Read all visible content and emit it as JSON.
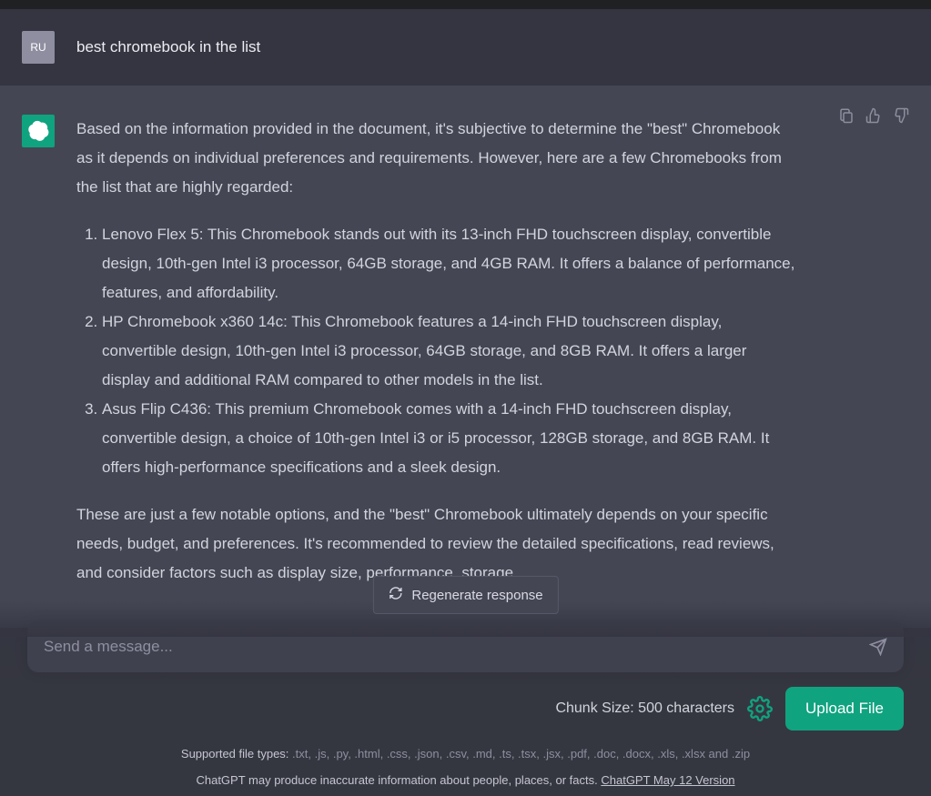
{
  "user": {
    "avatar_initials": "RU",
    "message": "best chromebook in the list"
  },
  "assistant": {
    "intro": "Based on the information provided in the document, it's subjective to determine the \"best\" Chromebook as it depends on individual preferences and requirements. However, here are a few Chromebooks from the list that are highly regarded:",
    "items": [
      "Lenovo Flex 5: This Chromebook stands out with its 13-inch FHD touchscreen display, convertible design, 10th-gen Intel i3 processor, 64GB storage, and 4GB RAM. It offers a balance of performance, features, and affordability.",
      "HP Chromebook x360 14c: This Chromebook features a 14-inch FHD touchscreen display, convertible design, 10th-gen Intel i3 processor, 64GB storage, and 8GB RAM. It offers a larger display and additional RAM compared to other models in the list.",
      "Asus Flip C436: This premium Chromebook comes with a 14-inch FHD touchscreen display, convertible design, a choice of 10th-gen Intel i3 or i5 processor, 128GB storage, and 8GB RAM. It offers high-performance specifications and a sleek design."
    ],
    "outro": "These are just a few notable options, and the \"best\" Chromebook ultimately depends on your specific needs, budget, and preferences. It's recommended to review the detailed specifications, read reviews, and consider factors such as display size, performance, storage,"
  },
  "controls": {
    "regenerate_label": "Regenerate response",
    "input_placeholder": "Send a message...",
    "chunk_label": "Chunk Size: 500 characters",
    "upload_label": "Upload File",
    "supported_label": "Supported file types: ",
    "supported_types": ".txt, .js, .py, .html, .css, .json, .csv, .md, .ts, .tsx, .jsx, .pdf, .doc, .docx, .xls, .xlsx and .zip",
    "disclaimer": "ChatGPT may produce inaccurate information about people, places, or facts. ",
    "version": "ChatGPT May 12 Version"
  }
}
